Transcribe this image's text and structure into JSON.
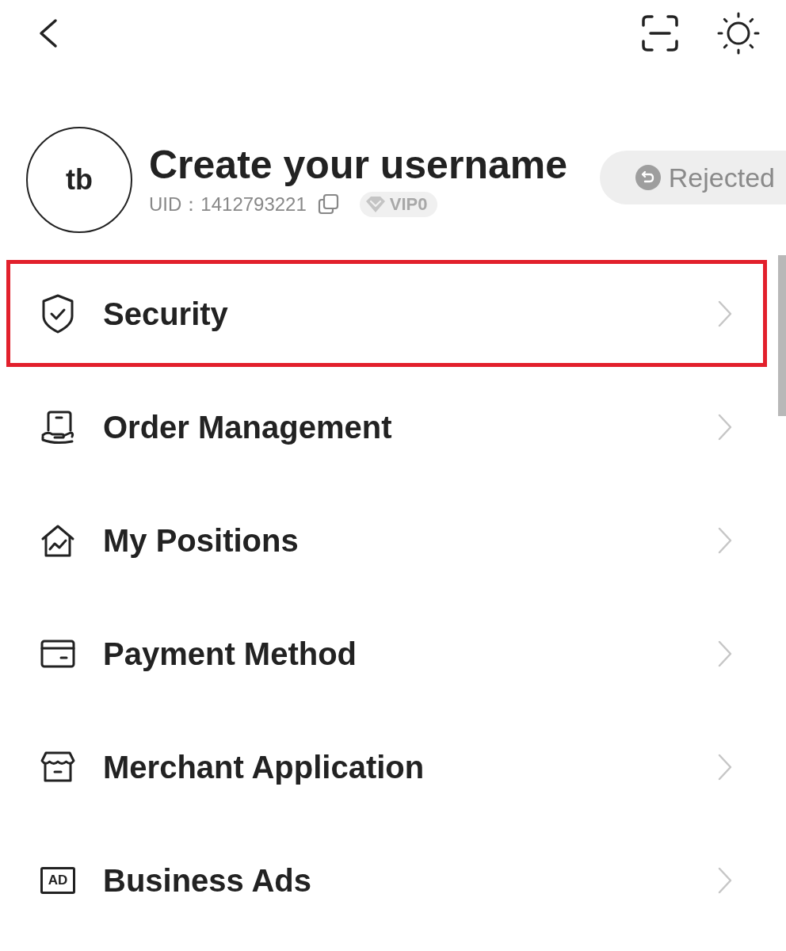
{
  "profile": {
    "avatar_initials": "tb",
    "name": "Create your username",
    "uid": "UID：1412793221",
    "vip_level": "VIP0",
    "status": "Rejected"
  },
  "menu": [
    {
      "kind": "security",
      "label": "Security",
      "highlighted": true
    },
    {
      "kind": "orders",
      "label": "Order Management",
      "highlighted": false
    },
    {
      "kind": "positions",
      "label": "My Positions",
      "highlighted": false
    },
    {
      "kind": "payment",
      "label": "Payment Method",
      "highlighted": false
    },
    {
      "kind": "merchant",
      "label": "Merchant Application",
      "highlighted": false
    },
    {
      "kind": "ads",
      "icon_label": "AD",
      "label": "Business Ads",
      "highlighted": false
    }
  ]
}
